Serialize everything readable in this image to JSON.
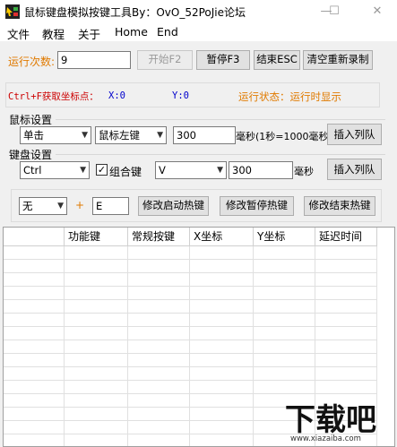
{
  "window": {
    "title": "鼠标键盘模拟按键工具By：OvO_52PoJie论坛",
    "minimize": "—",
    "maximize": "☐",
    "close": "✕"
  },
  "menu": [
    "文件",
    "教程",
    "关于",
    "Home",
    "End"
  ],
  "run": {
    "label": "运行次数:",
    "value": "9",
    "start_label": "开始F2",
    "pause_label": "暂停F3",
    "end_label": "结束ESC",
    "clear_label": "清空重新录制"
  },
  "status": {
    "hotkey_text": "Ctrl+F获取坐标点：",
    "x_label": "X:0",
    "y_label": "Y:0",
    "state_text": "运行状态：运行时显示"
  },
  "mouse": {
    "heading": "鼠标设置",
    "action": "单击",
    "button": "鼠标左键",
    "delay_value": "300",
    "delay_unit": "毫秒(1秒=1000毫秒",
    "insert_label": "插入列队"
  },
  "keyboard": {
    "heading": "键盘设置",
    "modifier": "Ctrl",
    "combo_label": "组合键",
    "combo_checked": "✓",
    "key": "V",
    "delay_value": "300",
    "delay_unit": "毫秒",
    "insert_label": "插入列队"
  },
  "hotkeys": {
    "modifier": "无",
    "plus": "+",
    "key_value": "E",
    "start_label": "修改启动热键",
    "pause_label": "修改暂停热键",
    "end_label": "修改结束热键"
  },
  "table": {
    "columns": [
      "",
      "功能键",
      "常规按键",
      "X坐标",
      "Y坐标",
      "延迟时间"
    ]
  },
  "watermark": {
    "big": "下载吧",
    "url": "www.xiazaiba.com"
  },
  "colors": {
    "orange": "#e07a00",
    "blue": "#0000cc",
    "red": "#cc0000"
  }
}
